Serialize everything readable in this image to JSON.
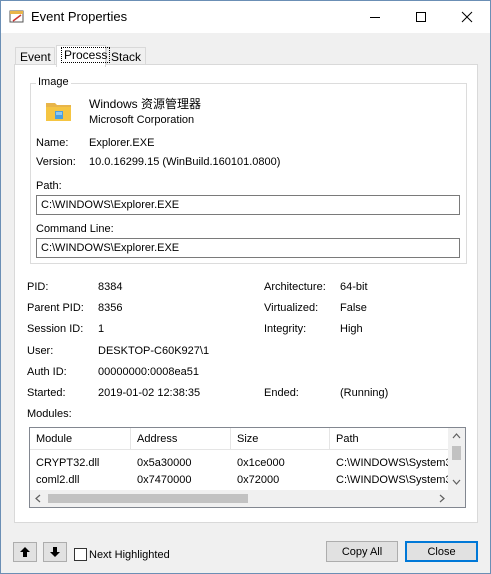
{
  "window": {
    "title": "Event Properties"
  },
  "tabs": [
    {
      "label": "Event"
    },
    {
      "label": "Process"
    },
    {
      "label": "Stack"
    }
  ],
  "image": {
    "group_label": "Image",
    "product": "Windows 资源管理器",
    "company": "Microsoft Corporation",
    "name_label": "Name:",
    "name_value": "Explorer.EXE",
    "version_label": "Version:",
    "version_value": "10.0.16299.15 (WinBuild.160101.0800)",
    "path_label": "Path:",
    "path_value": "C:\\WINDOWS\\Explorer.EXE",
    "cmdline_label": "Command Line:",
    "cmdline_value": "C:\\WINDOWS\\Explorer.EXE"
  },
  "details": {
    "pid_label": "PID:",
    "pid_value": "8384",
    "ppid_label": "Parent PID:",
    "ppid_value": "8356",
    "session_label": "Session ID:",
    "session_value": "1",
    "user_label": "User:",
    "user_value": "DESKTOP-C60K927\\1",
    "auth_label": "Auth ID:",
    "auth_value": "00000000:0008ea51",
    "started_label": "Started:",
    "started_value": "2019-01-02 12:38:35",
    "arch_label": "Architecture:",
    "arch_value": "64-bit",
    "virt_label": "Virtualized:",
    "virt_value": "False",
    "integrity_label": "Integrity:",
    "integrity_value": "High",
    "ended_label": "Ended:",
    "ended_value": "(Running)",
    "modules_label": "Modules:"
  },
  "modules": {
    "columns": [
      "Module",
      "Address",
      "Size",
      "Path"
    ],
    "rows": [
      [
        "CRYPT32.dll",
        "0x5a30000",
        "0x1ce000",
        "C:\\WINDOWS\\System3"
      ],
      [
        "coml2.dll",
        "0x7470000",
        "0x72000",
        "C:\\WINDOWS\\System3"
      ]
    ]
  },
  "footer": {
    "next_highlighted_label": "Next Highlighted",
    "copy_all_label": "Copy All",
    "close_label": "Close"
  },
  "colors": {
    "accent": "#0078d7",
    "folder_yellow": "#f5c542"
  }
}
